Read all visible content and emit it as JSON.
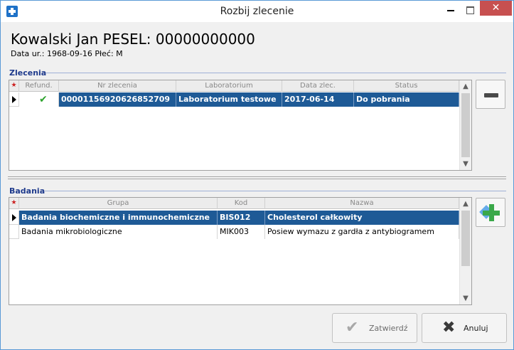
{
  "window": {
    "title": "Rozbij zlecenie",
    "close_glyph": "✕",
    "icons": {
      "app": "medical-cross-icon",
      "minimize": "minimize-icon",
      "maximize": "maximize-icon",
      "close": "close-icon"
    }
  },
  "patient": {
    "name_line": "Kowalski Jan PESEL: 00000000000",
    "info_line": "Data ur.: 1968-09-16 Płeć: M"
  },
  "orders": {
    "label": "Zlecenia",
    "star": "★",
    "headers": {
      "refund": "Refund.",
      "number": "Nr zlecenia",
      "lab": "Laboratorium",
      "date": "Data zlec.",
      "status": "Status"
    },
    "rows": [
      {
        "refund": "✔",
        "number": "00001156920626852709",
        "lab": "Laboratorium testowe",
        "date": "2017-06-14",
        "status": "Do pobrania",
        "selected": true
      }
    ],
    "scroll_up": "▲",
    "scroll_down": "▼"
  },
  "tests": {
    "label": "Badania",
    "star": "★",
    "headers": {
      "group": "Grupa",
      "code": "Kod",
      "name": "Nazwa"
    },
    "rows": [
      {
        "group": "Badania biochemiczne i immunochemiczne",
        "code": "BIS012",
        "name": "Cholesterol całkowity",
        "selected": true
      },
      {
        "group": "Badania mikrobiologiczne",
        "code": "MIK003",
        "name": "Posiew wymazu z gardła z antybiogramem",
        "selected": false
      }
    ],
    "scroll_up": "▲",
    "scroll_down": "▼"
  },
  "buttons": {
    "confirm": "Zatwierdź",
    "cancel": "Anuluj",
    "confirm_glyph": "✔",
    "cancel_glyph": "✖",
    "icons": {
      "remove": "minus-icon",
      "add": "add-green-plus-icon",
      "confirm": "checkmark-icon",
      "cancel": "x-icon"
    }
  },
  "colors": {
    "selection": "#1e5a96",
    "section_label": "#1e3a8c",
    "check": "#2da32d",
    "close_button": "#c75050"
  }
}
